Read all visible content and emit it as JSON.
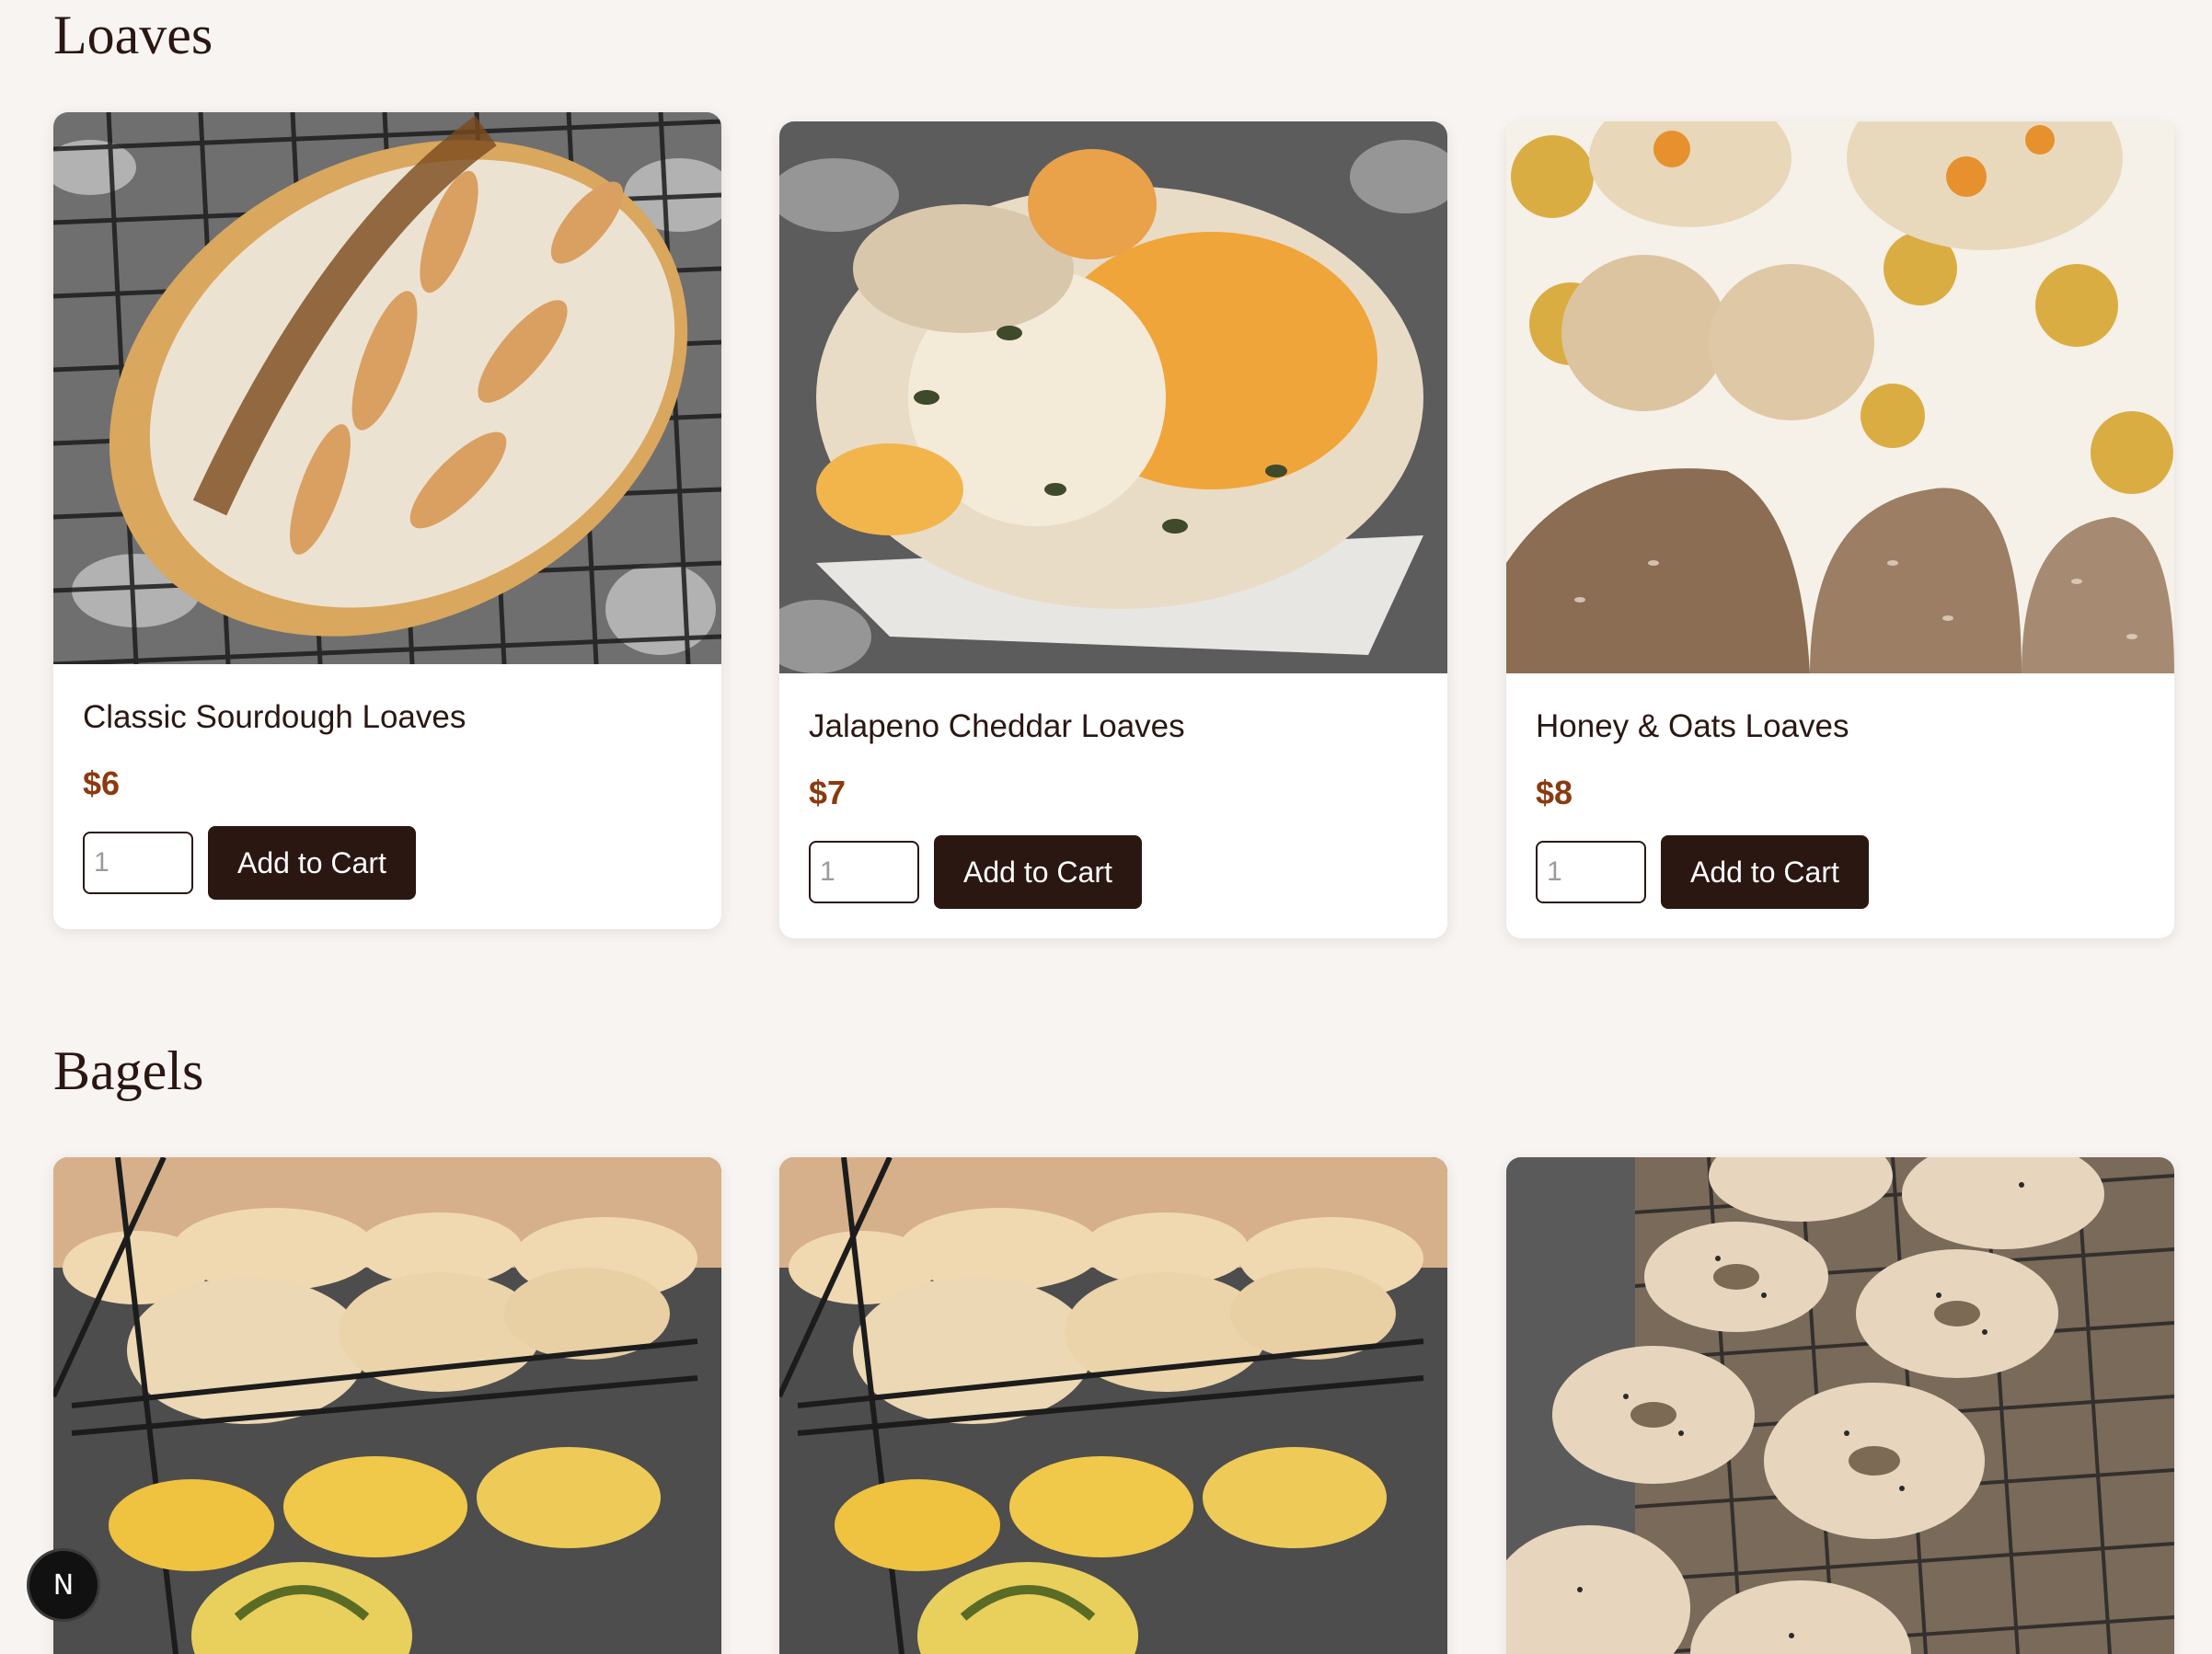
{
  "sections": [
    {
      "title": "Loaves",
      "products": [
        {
          "name": "Classic Sourdough Loaves",
          "price": "$6",
          "qty_placeholder": "1",
          "button_label": "Add to Cart",
          "image": "sourdough-loaf-photo"
        },
        {
          "name": "Jalapeno Cheddar Loaves",
          "price": "$7",
          "qty_placeholder": "1",
          "button_label": "Add to Cart",
          "image": "jalapeno-cheddar-loaf-photo"
        },
        {
          "name": "Honey & Oats Loaves",
          "price": "$8",
          "qty_placeholder": "1",
          "button_label": "Add to Cart",
          "image": "honey-oats-loaves-photo"
        }
      ]
    },
    {
      "title": "Bagels",
      "products": [
        {
          "image": "bagels-on-rack-photo"
        },
        {
          "image": "bagels-on-rack-photo"
        },
        {
          "image": "everything-bagels-photo"
        }
      ]
    }
  ],
  "dev_badge": {
    "label": "N",
    "icon": "nextjs-icon"
  },
  "colors": {
    "background": "#f8f4f1",
    "text": "#2a1712",
    "price": "#8b3a0f",
    "button": "#2a1712"
  }
}
